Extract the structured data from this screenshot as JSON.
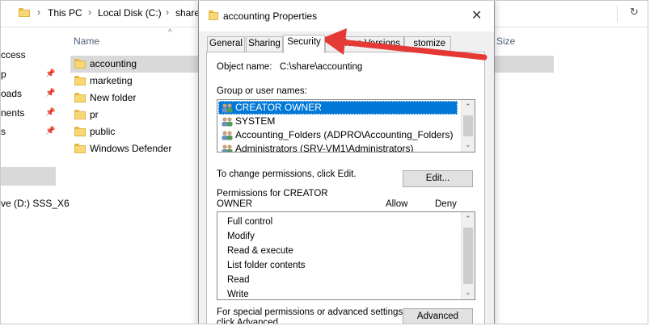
{
  "explorer": {
    "address": {
      "crumbs": [
        "This PC",
        "Local Disk (C:)",
        "share"
      ]
    },
    "nav_items": [
      {
        "label": "ccess",
        "pinned": false
      },
      {
        "label": "p",
        "pinned": true
      },
      {
        "label": "oads",
        "pinned": true
      },
      {
        "label": "nents",
        "pinned": true
      },
      {
        "label": "s",
        "pinned": true
      },
      {
        "label": "ve (D:) SSS_X6",
        "pinned": false
      }
    ],
    "columns": {
      "name": "Name",
      "size": "Size"
    },
    "folders": [
      "accounting",
      "marketing",
      "New folder",
      "pr",
      "public",
      "Windows Defender"
    ],
    "selected_folder": "accounting"
  },
  "dialog": {
    "title": "accounting Properties",
    "tabs": [
      "General",
      "Sharing",
      "Security",
      "Previous Versions",
      "Customize"
    ],
    "tab_partials": {
      "previous_versions": "ious Versions",
      "customize": "stomize"
    },
    "active_tab": "Security",
    "object_name_label": "Object name:",
    "object_name_value": "C:\\share\\accounting",
    "group_label": "Group or user names:",
    "users": [
      "CREATOR OWNER",
      "SYSTEM",
      "Accounting_Folders (ADPRO\\Accounting_Folders)",
      "Administrators (SRV-VM1\\Administrators)"
    ],
    "selected_user": "CREATOR OWNER",
    "change_text": "To change permissions, click Edit.",
    "edit_button": "Edit...",
    "perm_label_line1": "Permissions for CREATOR",
    "perm_label_line2": "OWNER",
    "allow_header": "Allow",
    "deny_header": "Deny",
    "permissions": [
      "Full control",
      "Modify",
      "Read & execute",
      "List folder contents",
      "Read",
      "Write"
    ],
    "special_text_line1": "For special permissions or advanced settings,",
    "special_text_line2": "click Advanced.",
    "advanced_button": "Advanced"
  },
  "colors": {
    "accent": "#0078d7",
    "annotation_arrow": "#e53935",
    "folder": "#f8d775"
  },
  "icons": {
    "folder": "folder-icon",
    "users": "user-group-icon",
    "close": "close-icon",
    "pin": "pin-icon",
    "scroll_up": "chevron-up-icon",
    "scroll_down": "chevron-down-icon"
  }
}
